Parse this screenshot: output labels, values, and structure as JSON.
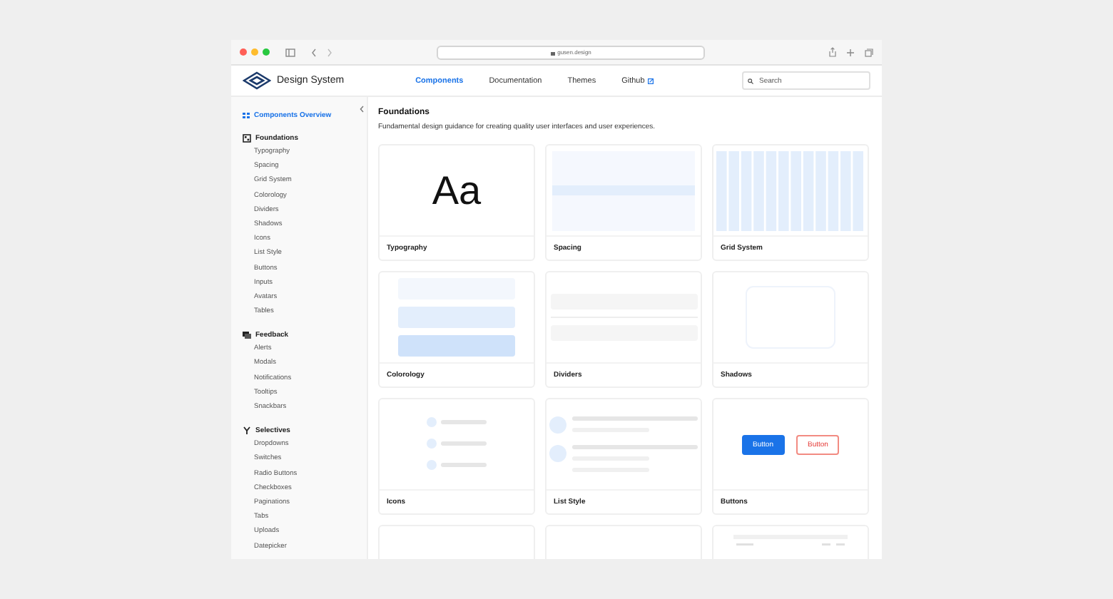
{
  "browser": {
    "url": "gusen.design"
  },
  "header": {
    "logo": "Design System",
    "nav": [
      {
        "label": "Components",
        "selected": true,
        "external": false
      },
      {
        "label": "Documentation",
        "selected": false,
        "external": false
      },
      {
        "label": "Themes",
        "selected": false,
        "external": false
      },
      {
        "label": "Github",
        "selected": false,
        "external": true
      }
    ],
    "search": {
      "placeholder": "Search"
    }
  },
  "sidebar": {
    "overview": {
      "label": "Components Overview",
      "selected": true
    },
    "groups": [
      {
        "title": "Foundations",
        "kind": "grid",
        "items": [
          "Typography",
          "Spacing",
          "Grid System",
          "Colorology",
          "Dividers",
          "Shadows",
          "Icons",
          "List Style",
          "Buttons",
          "Inputs",
          "Avatars",
          "Tables"
        ]
      },
      {
        "title": "Feedback",
        "kind": "chat",
        "items": [
          "Alerts",
          "Modals",
          "Notifications",
          "Tooltips",
          "Snackbars"
        ]
      },
      {
        "title": "Selectives",
        "kind": "branch",
        "items": [
          "Dropdowns",
          "Switches",
          "Radio Buttons",
          "Checkboxes",
          "Paginations",
          "Tabs",
          "Uploads",
          "Datepicker"
        ]
      }
    ]
  },
  "content": {
    "title": "Foundations",
    "description": "Fundamental design guidance for creating quality user interfaces and user experiences.",
    "cards": [
      {
        "kind": "typography",
        "title": "Typography",
        "sample": "Aa"
      },
      {
        "kind": "spacing",
        "title": "Spacing"
      },
      {
        "kind": "grid",
        "title": "Grid System"
      },
      {
        "kind": "colors",
        "title": "Colorology"
      },
      {
        "kind": "dividers",
        "title": "Dividers"
      },
      {
        "kind": "shadows",
        "title": "Shadows"
      },
      {
        "kind": "icons",
        "title": "Icons"
      },
      {
        "kind": "list",
        "title": "List Style"
      },
      {
        "kind": "buttons",
        "title": "Buttons",
        "buttons": [
          "Button",
          "Button"
        ]
      },
      {
        "kind": "blank"
      },
      {
        "kind": "blank"
      },
      {
        "kind": "table"
      }
    ]
  }
}
